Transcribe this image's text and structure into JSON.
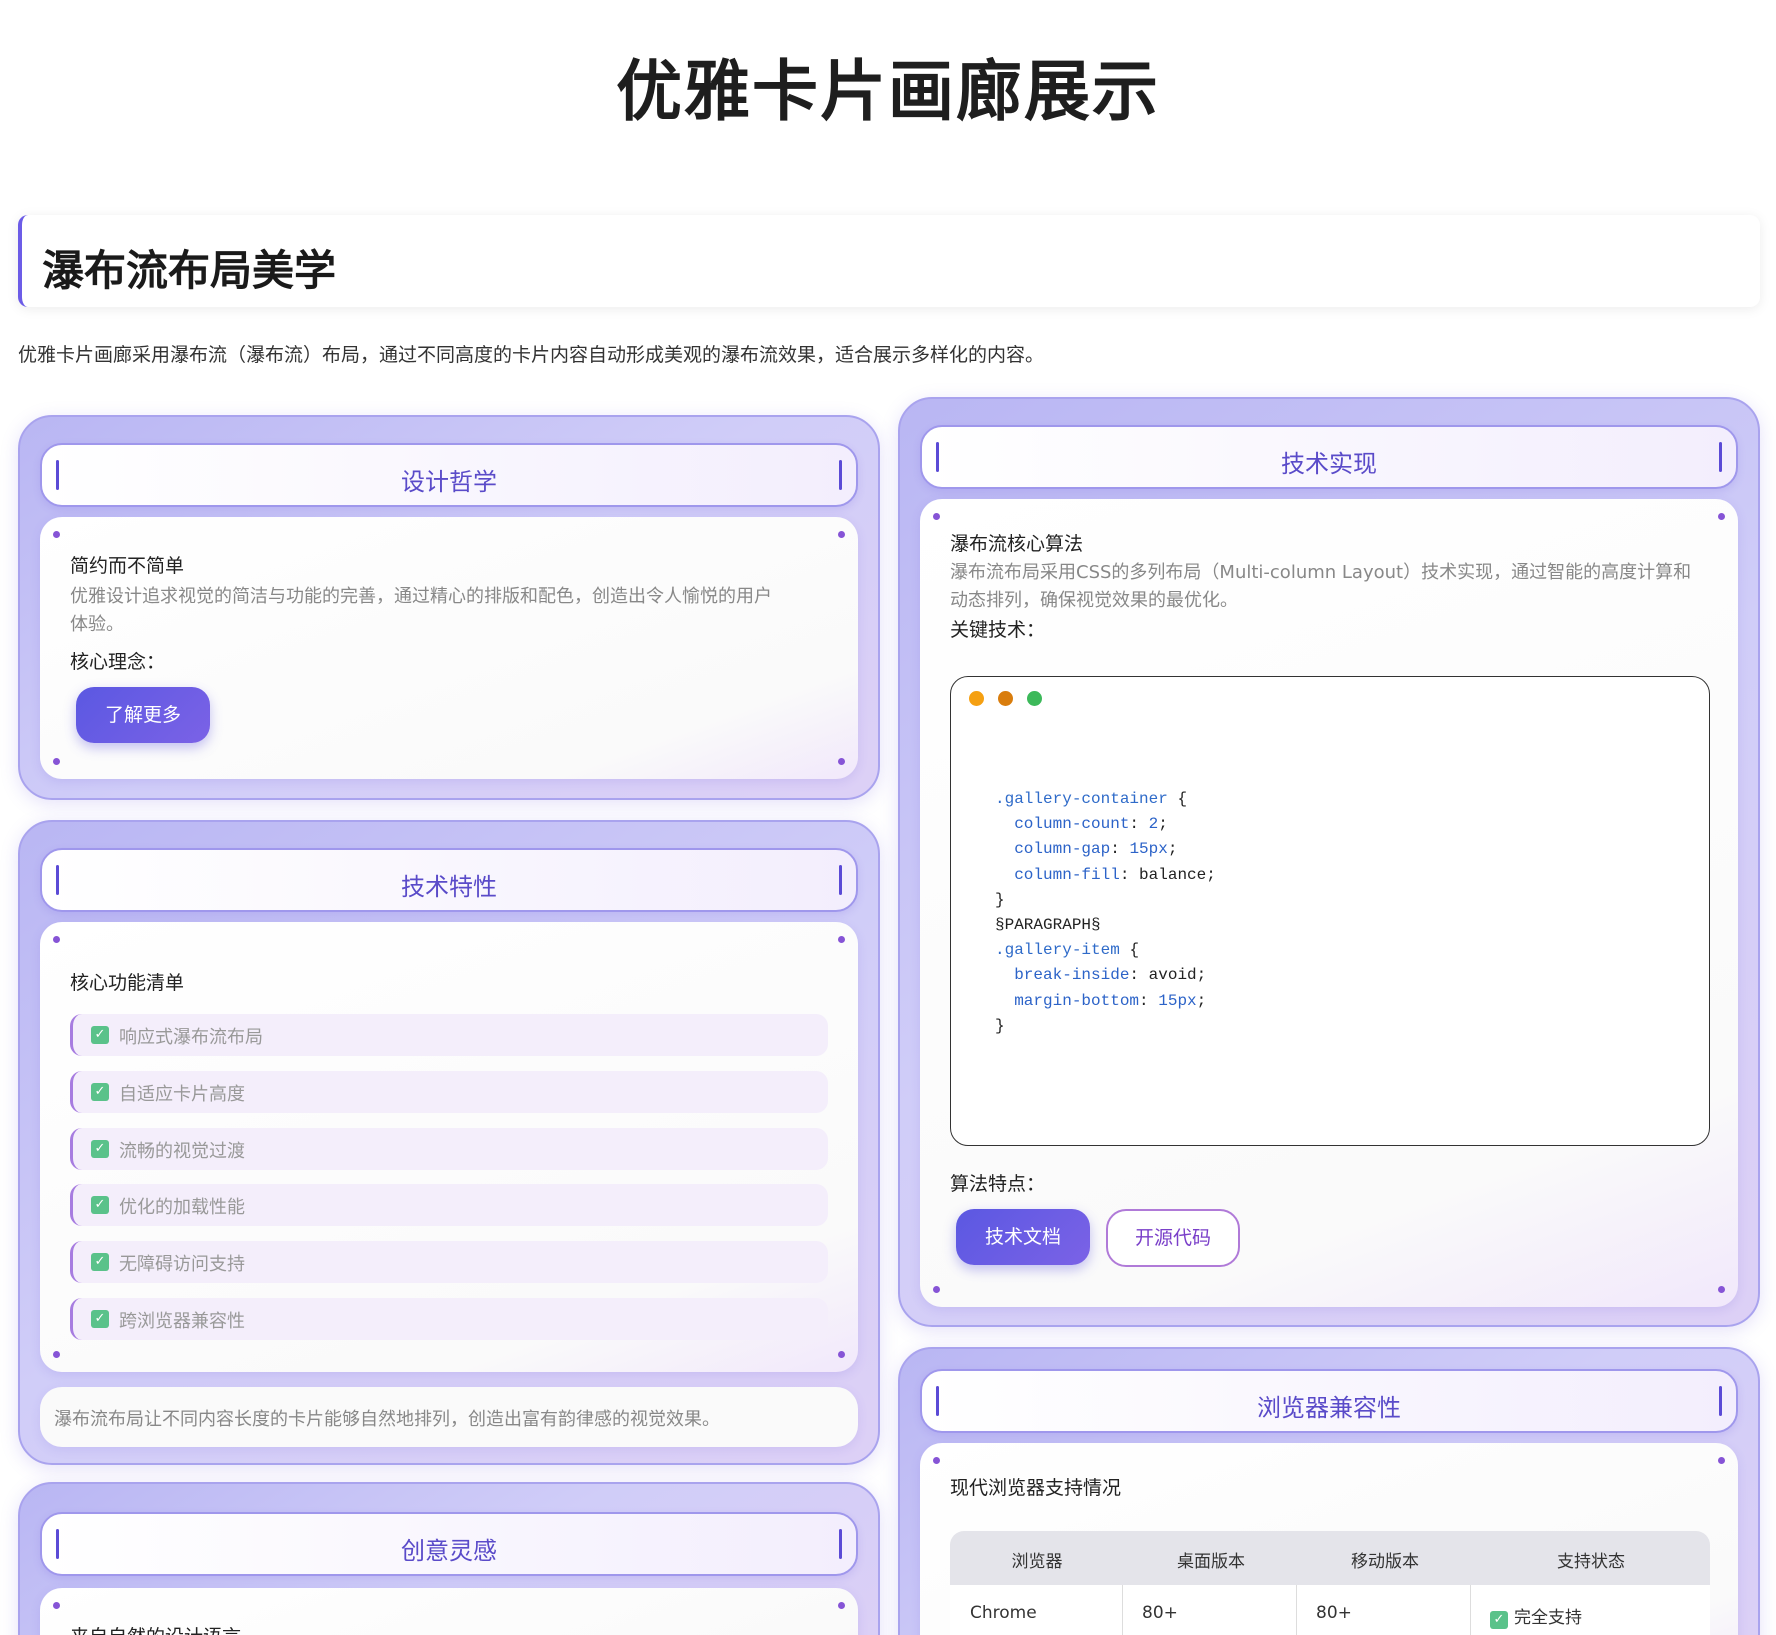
{
  "page": {
    "title": "优雅卡片画廊展示",
    "section_title": "瀑布流布局美学",
    "intro": "优雅卡片画廊采用瀑布流（瀑布流）布局，通过不同高度的卡片内容自动形成美观的瀑布流效果，适合展示多样化的内容。"
  },
  "cards": {
    "design": {
      "title": "设计哲学",
      "subtitle": "简约而不简单",
      "desc_line1": "优雅设计追求视觉的简洁与功能的完善，通过精心的排版和配色，创造出令人愉悦的用户",
      "desc_line2": "体验。",
      "concept_label": "核心理念：",
      "button": "了解更多"
    },
    "features": {
      "title": "技术特性",
      "subtitle": "核心功能清单",
      "items": [
        "响应式瀑布流布局",
        "自适应卡片高度",
        "流畅的视觉过渡",
        "优化的加载性能",
        "无障碍访问支持",
        "跨浏览器兼容性"
      ],
      "quote": "瀑布流布局让不同内容长度的卡片能够自然地排列，创造出富有韵律感的视觉效果。"
    },
    "creative": {
      "title": "创意灵感",
      "subtitle": "来自自然的设计语言"
    },
    "tech": {
      "title": "技术实现",
      "subtitle": "瀑布流核心算法",
      "desc_line1": "瀑布流布局采用CSS的多列布局（Multi-column Layout）技术实现，通过智能的高度计算和",
      "desc_line2": "动态排列，确保视觉效果的最优化。",
      "key_label": "关键技术：",
      "algo_label": "算法特点：",
      "btn_docs": "技术文档",
      "btn_source": "开源代码",
      "code": {
        "sel1": ".gallery-container",
        "p1": "column-count",
        "v1": "2",
        "p2": "column-gap",
        "v2": "15px",
        "p3": "column-fill",
        "v3": "balance",
        "para": "§PARAGRAPH§",
        "sel2": ".gallery-item",
        "p4": "break-inside",
        "v4": "avoid",
        "p5": "margin-bottom",
        "v5": "15px",
        "open": "{",
        "close": "}",
        "colon": ":",
        "semi": ";"
      },
      "window_dots": [
        "#f5a012",
        "#d97d0d",
        "#3cb95a"
      ]
    },
    "browser": {
      "title": "浏览器兼容性",
      "subtitle": "现代浏览器支持情况",
      "headers": [
        "浏览器",
        "桌面版本",
        "移动版本",
        "支持状态"
      ],
      "rows": [
        {
          "browser": "Chrome",
          "desktop": "80+",
          "mobile": "80+",
          "status": "完全支持"
        }
      ]
    }
  },
  "icons": {
    "check": "✓"
  },
  "colors": {
    "accent": "#6c5ce7",
    "card_title": "#5a4bc9",
    "success": "#5ac28a"
  }
}
